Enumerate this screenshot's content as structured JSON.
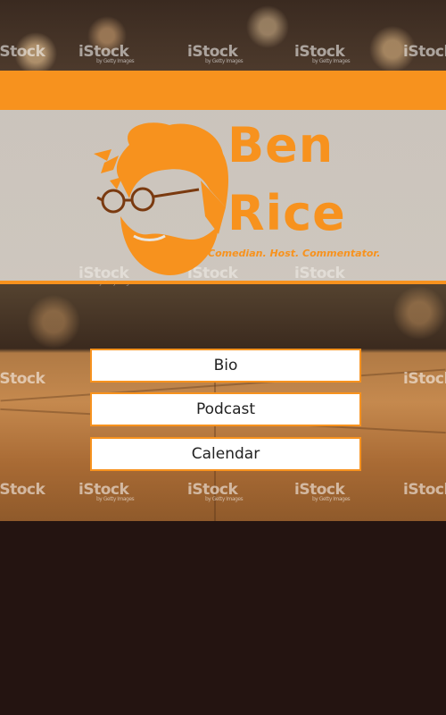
{
  "brand": {
    "first_name": "Ben",
    "last_name": "Rice",
    "tagline": "Comedian. Host. Commentator."
  },
  "nav": {
    "items": [
      {
        "label": "Bio"
      },
      {
        "label": "Podcast"
      },
      {
        "label": "Calendar"
      }
    ]
  },
  "watermark": {
    "text": "iStock",
    "subtext": "by Getty Images"
  },
  "colors": {
    "accent": "#f7921e",
    "footer": "#241411",
    "button_bg": "#ffffff"
  }
}
